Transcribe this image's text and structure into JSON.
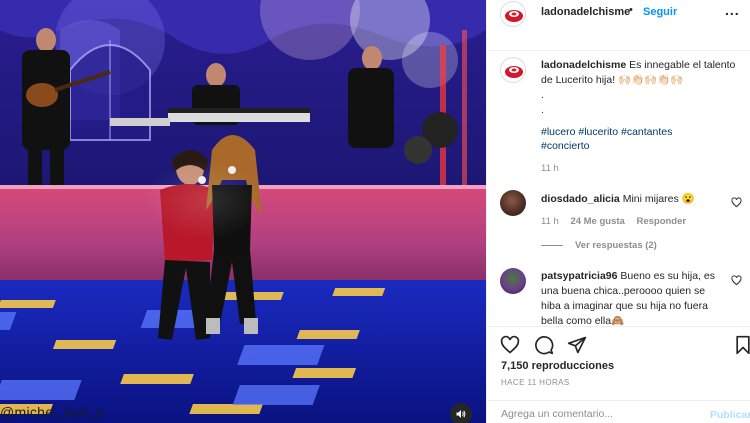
{
  "video": {
    "watermark": "@michel_kurl_s",
    "sound_icon": "speaker-icon"
  },
  "header": {
    "username": "ladonadelchisme",
    "separator": "•",
    "follow_label": "Seguir",
    "more_label": "..."
  },
  "caption": {
    "username": "ladonadelchisme",
    "text": "Es innegable el talento de Lucerito hija! 🙌🏻👏🏻🙌🏻👏🏻🙌🏻",
    "dot1": ".",
    "dot2": ".",
    "tags": [
      "#lucero",
      "#lucerito",
      "#cantantes",
      "#concierto"
    ],
    "time": "11 h"
  },
  "comments": [
    {
      "username": "diosdado_alicia",
      "text": "Mini mijares 😮",
      "time": "11 h",
      "likes": "24 Me gusta",
      "reply_label": "Responder",
      "view_replies": "Ver respuestas (2)"
    },
    {
      "username": "patsypatricia96",
      "text": "Bueno es su hija, es una buena chica..peroooo quien se hiba a imaginar que su hija no fuera bella como ella🙈"
    }
  ],
  "actions": {
    "views": "7,150 reproducciones",
    "ago": "HACE 11 HORAS",
    "comment_placeholder": "Agrega un comentario...",
    "publish_label": "Publicar"
  },
  "colors": {
    "accent": "#0095f6",
    "link": "#00376b",
    "muted": "#8e8e8e",
    "stage_blue": "#1f2fd0"
  }
}
